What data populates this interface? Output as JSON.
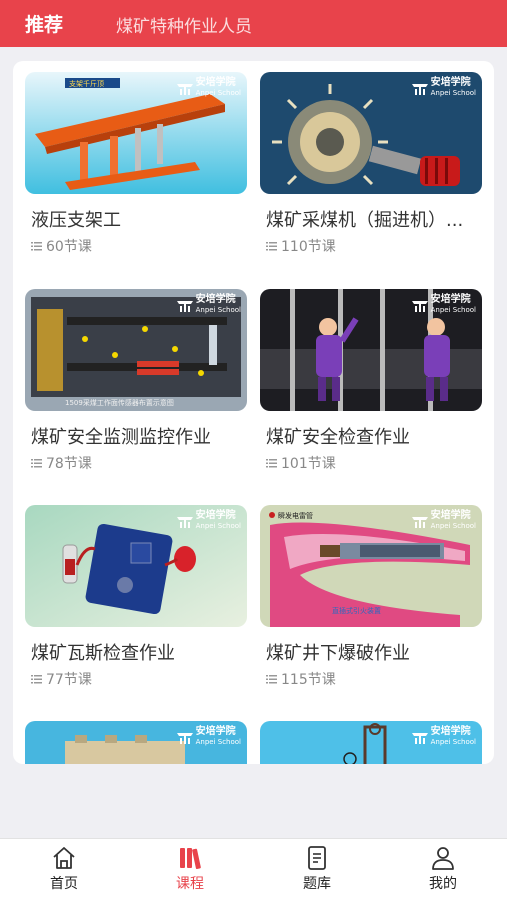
{
  "header": {
    "tab_recommend": "推荐",
    "tab_category": "煤矿特种作业人员"
  },
  "brand": {
    "name_cn": "安培学院",
    "name_en": "Anpei School"
  },
  "courses": [
    {
      "title": "液压支架工",
      "lessons": "60节课",
      "thumb_caption": "支架千斤顶",
      "theme": "hydraulic-support"
    },
    {
      "title": "煤矿采煤机（掘进机）...",
      "lessons": "110节课",
      "theme": "shearer"
    },
    {
      "title": "煤矿安全监测监控作业",
      "lessons": "78节课",
      "thumb_caption": "1509采煤工作面传感器布置示意图",
      "theme": "monitoring"
    },
    {
      "title": "煤矿安全检查作业",
      "lessons": "101节课",
      "theme": "inspection"
    },
    {
      "title": "煤矿瓦斯检查作业",
      "lessons": "77节课",
      "theme": "gas"
    },
    {
      "title": "煤矿井下爆破作业",
      "lessons": "115节课",
      "thumb_caption": "瞬发电雷管",
      "thumb_caption2": "直插式引火装置",
      "theme": "blasting"
    }
  ],
  "nav": [
    {
      "label": "首页",
      "icon": "home-icon",
      "active": false
    },
    {
      "label": "课程",
      "icon": "books-icon",
      "active": true
    },
    {
      "label": "题库",
      "icon": "document-icon",
      "active": false
    },
    {
      "label": "我的",
      "icon": "person-icon",
      "active": false
    }
  ],
  "colors": {
    "accent": "#e8434b",
    "background": "#efeff3"
  }
}
